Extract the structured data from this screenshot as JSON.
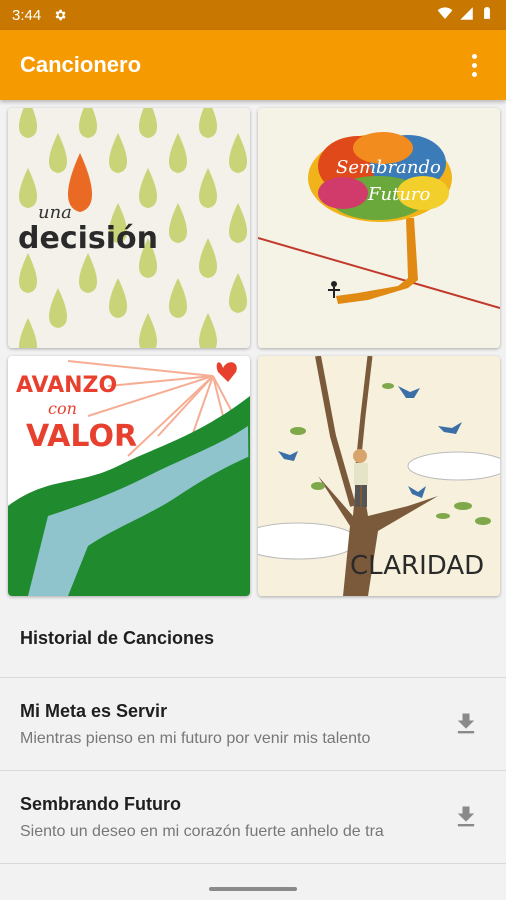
{
  "status_bar": {
    "time": "3:44",
    "icons": [
      "gear-icon",
      "wifi-icon",
      "signal-icon",
      "battery-icon"
    ]
  },
  "app_bar": {
    "title": "Cancionero",
    "menu_icon": "more-vert-icon",
    "color": "#f59a00"
  },
  "albums": [
    {
      "name": "una decisión",
      "title_small": "una",
      "title_big": "decisión"
    },
    {
      "name": "Sembrando Futuro",
      "title_line1": "Sembrando",
      "title_line2": "Futuro"
    },
    {
      "name": "Avanzo con Valor",
      "title_line1": "AVANZO",
      "title_line2": "con",
      "title_line3": "VALOR"
    },
    {
      "name": "Claridad",
      "title": "CLARIDAD"
    }
  ],
  "history": {
    "header": "Historial de Canciones",
    "items": [
      {
        "title": "Mi Meta es Servir",
        "subtitle": "Mientras pienso en mi futuro por venir mis talento",
        "icon": "download-icon"
      },
      {
        "title": "Sembrando Futuro",
        "subtitle": "Siento un deseo en mi corazón fuerte anhelo de tra",
        "icon": "download-icon"
      }
    ]
  }
}
